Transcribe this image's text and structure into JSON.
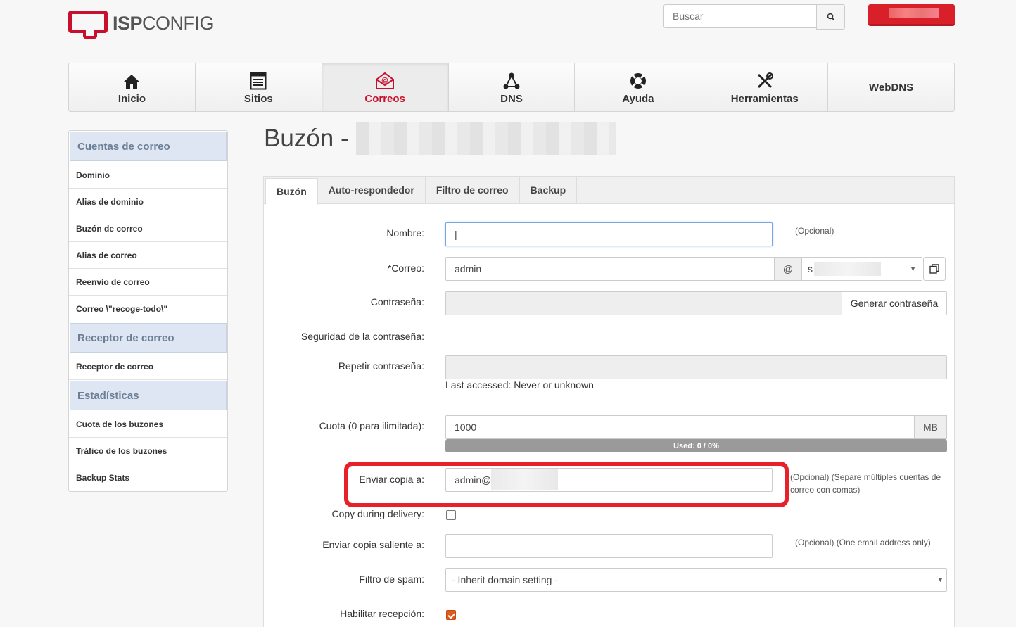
{
  "header": {
    "logo_bold": "ISP",
    "logo_light": "CONFIG",
    "search_placeholder": "Buscar"
  },
  "colors": {
    "brand": "#c8102e",
    "active_nav": "#c8102e",
    "sidebar_head": "#dde6f2"
  },
  "nav": [
    {
      "label": "Inicio",
      "icon": "home-icon"
    },
    {
      "label": "Sitios",
      "icon": "sites-icon"
    },
    {
      "label": "Correos",
      "icon": "mail-icon",
      "active": true
    },
    {
      "label": "DNS",
      "icon": "dns-icon"
    },
    {
      "label": "Ayuda",
      "icon": "lifebuoy-icon"
    },
    {
      "label": "Herramientas",
      "icon": "tools-icon"
    },
    {
      "label": "WebDNS",
      "icon": ""
    }
  ],
  "sidebar": {
    "sections": [
      {
        "title": "Cuentas de correo",
        "items": [
          "Dominio",
          "Alias de dominio",
          "Buzón de correo",
          "Alias de correo",
          "Reenvío de correo",
          "Correo \\\"recoge-todo\\\""
        ]
      },
      {
        "title": "Receptor de correo",
        "items": [
          "Receptor de correo"
        ]
      },
      {
        "title": "Estadísticas",
        "items": [
          "Cuota de los buzones",
          "Tráfico de los buzones",
          "Backup Stats"
        ]
      }
    ]
  },
  "page": {
    "title": "Buzón -"
  },
  "tabs": [
    "Buzón",
    "Auto-respondedor",
    "Filtro de correo",
    "Backup"
  ],
  "form": {
    "nombre_label": "Nombre:",
    "nombre_value": "|",
    "nombre_hint": "(Opcional)",
    "correo_label": "Correo:",
    "correo_required": "*",
    "correo_value": "admin",
    "correo_at": "@",
    "correo_domain_prefix": "s",
    "contrasena_label": "Contraseña:",
    "generar_label": "Generar contraseña",
    "seguridad_label": "Seguridad de la contraseña:",
    "repetir_label": "Repetir contraseña:",
    "last_accessed": "Last accessed: Never or unknown",
    "cuota_label": "Cuota (0 para ilimitada):",
    "cuota_value": "1000",
    "cuota_unit": "MB",
    "used_text": "Used: 0 / 0%",
    "used_fraction": 0,
    "enviar_copia_label": "Enviar copia a:",
    "enviar_copia_value": "admin@",
    "enviar_copia_hint": "(Opcional) (Separe múltiples cuentas de correo con comas)",
    "copy_delivery_label": "Copy during delivery:",
    "copy_delivery_checked": false,
    "enviar_saliente_label": "Enviar copia saliente a:",
    "enviar_saliente_hint": "(Opcional) (One email address only)",
    "spam_label": "Filtro de spam:",
    "spam_value": "- Inherit domain setting -",
    "recepcion_label": "Habilitar recepción:",
    "recepcion_checked": true
  }
}
